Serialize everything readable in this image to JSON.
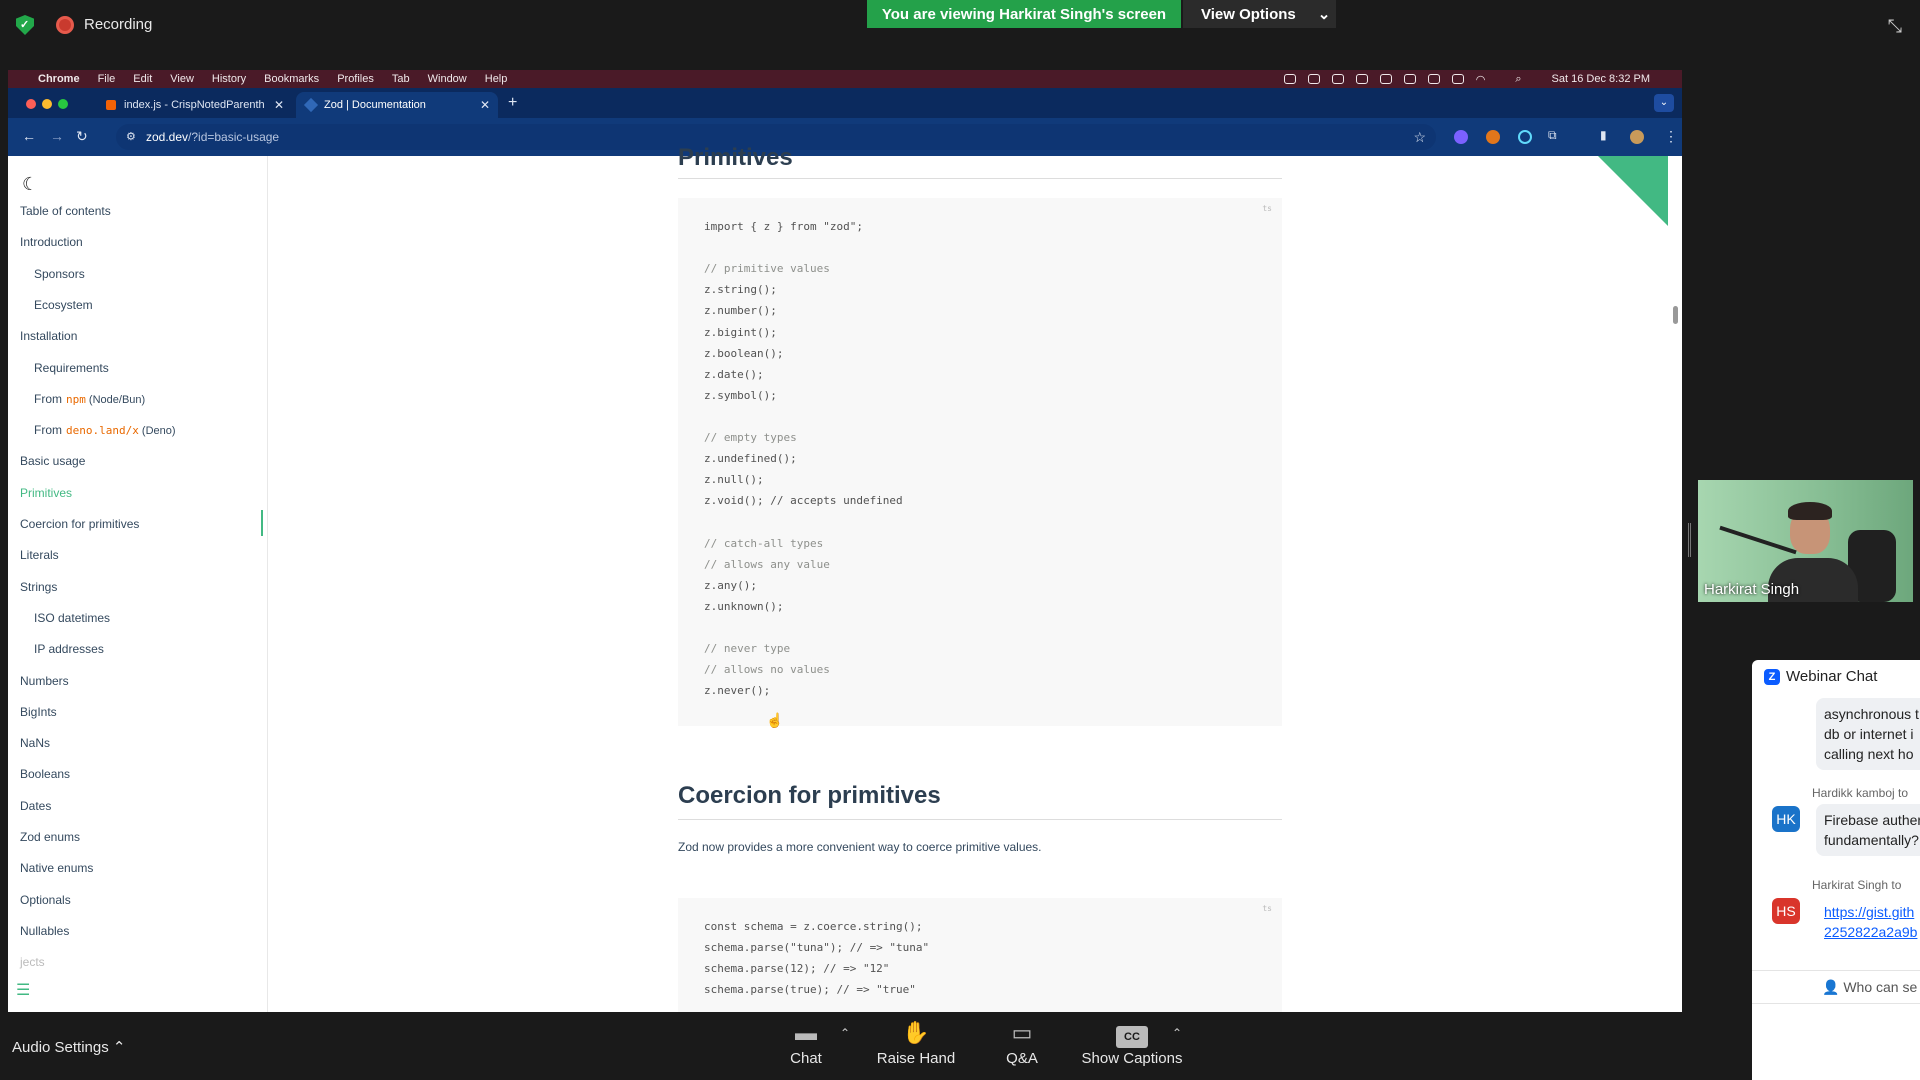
{
  "zoom": {
    "recording_label": "Recording",
    "viewing_banner": "You are viewing Harkirat Singh's screen",
    "view_options": "View Options",
    "audio_settings": "Audio Settings",
    "toolbar": [
      {
        "label": "Chat",
        "icon": "chat-icon"
      },
      {
        "label": "Raise Hand",
        "icon": "raise-hand-icon"
      },
      {
        "label": "Q&A",
        "icon": "qa-icon"
      },
      {
        "label": "Show Captions",
        "icon": "cc-icon",
        "badge": "CC"
      }
    ],
    "video_name": "Harkirat Singh",
    "chat": {
      "title": "Webinar Chat",
      "messages": [
        {
          "sender": "",
          "text": "asynchronous t db or internet i calling next ho"
        },
        {
          "sender": "Hardikk kamboj to",
          "avatar": "HK",
          "avatar_color": "#1a73c9",
          "text": "Firebase authen fundamentally?"
        },
        {
          "sender": "Harkirat Singh to",
          "avatar": "HS",
          "avatar_color": "#d9352b",
          "text": "https://gist.gith 2252822a2a9b"
        }
      ],
      "who_can_see": "Who can se"
    }
  },
  "mac": {
    "menus": [
      "Chrome",
      "File",
      "Edit",
      "View",
      "History",
      "Bookmarks",
      "Profiles",
      "Tab",
      "Window",
      "Help"
    ],
    "clock": "Sat 16 Dec  8:32 PM"
  },
  "browser": {
    "tabs": [
      {
        "title": "index.js - CrispNotedParenth"
      },
      {
        "title": "Zod | Documentation"
      }
    ],
    "url_host": "zod.dev",
    "url_path": "/?id=basic-usage"
  },
  "sidebar": {
    "items": [
      {
        "label": "Table of contents",
        "sub": false
      },
      {
        "label": "Introduction",
        "sub": false
      },
      {
        "label": "Sponsors",
        "sub": true
      },
      {
        "label": "Ecosystem",
        "sub": true
      },
      {
        "label": "Installation",
        "sub": false
      },
      {
        "label": "Requirements",
        "sub": true
      },
      {
        "label": "From",
        "code": "npm",
        "suffix": " (Node/Bun)",
        "sub": true
      },
      {
        "label": "From",
        "code": "deno.land/x",
        "suffix": " (Deno)",
        "sub": true
      },
      {
        "label": "Basic usage",
        "sub": false
      },
      {
        "label": "Primitives",
        "sub": false,
        "active": true
      },
      {
        "label": "Coercion for primitives",
        "sub": false
      },
      {
        "label": "Literals",
        "sub": false
      },
      {
        "label": "Strings",
        "sub": false
      },
      {
        "label": "ISO datetimes",
        "sub": true
      },
      {
        "label": "IP addresses",
        "sub": true
      },
      {
        "label": "Numbers",
        "sub": false
      },
      {
        "label": "BigInts",
        "sub": false
      },
      {
        "label": "NaNs",
        "sub": false
      },
      {
        "label": "Booleans",
        "sub": false
      },
      {
        "label": "Dates",
        "sub": false
      },
      {
        "label": "Zod enums",
        "sub": false
      },
      {
        "label": "Native enums",
        "sub": false
      },
      {
        "label": "Optionals",
        "sub": false
      },
      {
        "label": "Nullables",
        "sub": false
      },
      {
        "label": "jects",
        "sub": false
      }
    ]
  },
  "content": {
    "heading_primitives": "Primitives",
    "code1": [
      "import { z } from \"zod\";",
      "",
      "// primitive values",
      "z.string();",
      "z.number();",
      "z.bigint();",
      "z.boolean();",
      "z.date();",
      "z.symbol();",
      "",
      "// empty types",
      "z.undefined();",
      "z.null();",
      "z.void(); // accepts undefined",
      "",
      "// catch-all types",
      "// allows any value",
      "z.any();",
      "z.unknown();",
      "",
      "// never type",
      "// allows no values",
      "z.never();"
    ],
    "heading_coercion": "Coercion for primitives",
    "coercion_desc": "Zod now provides a more convenient way to coerce primitive values.",
    "code2": [
      "const schema = z.coerce.string();",
      "schema.parse(\"tuna\"); // => \"tuna\"",
      "schema.parse(12); // => \"12\"",
      "schema.parse(true); // => \"true\""
    ],
    "copy_hint": "ts"
  }
}
